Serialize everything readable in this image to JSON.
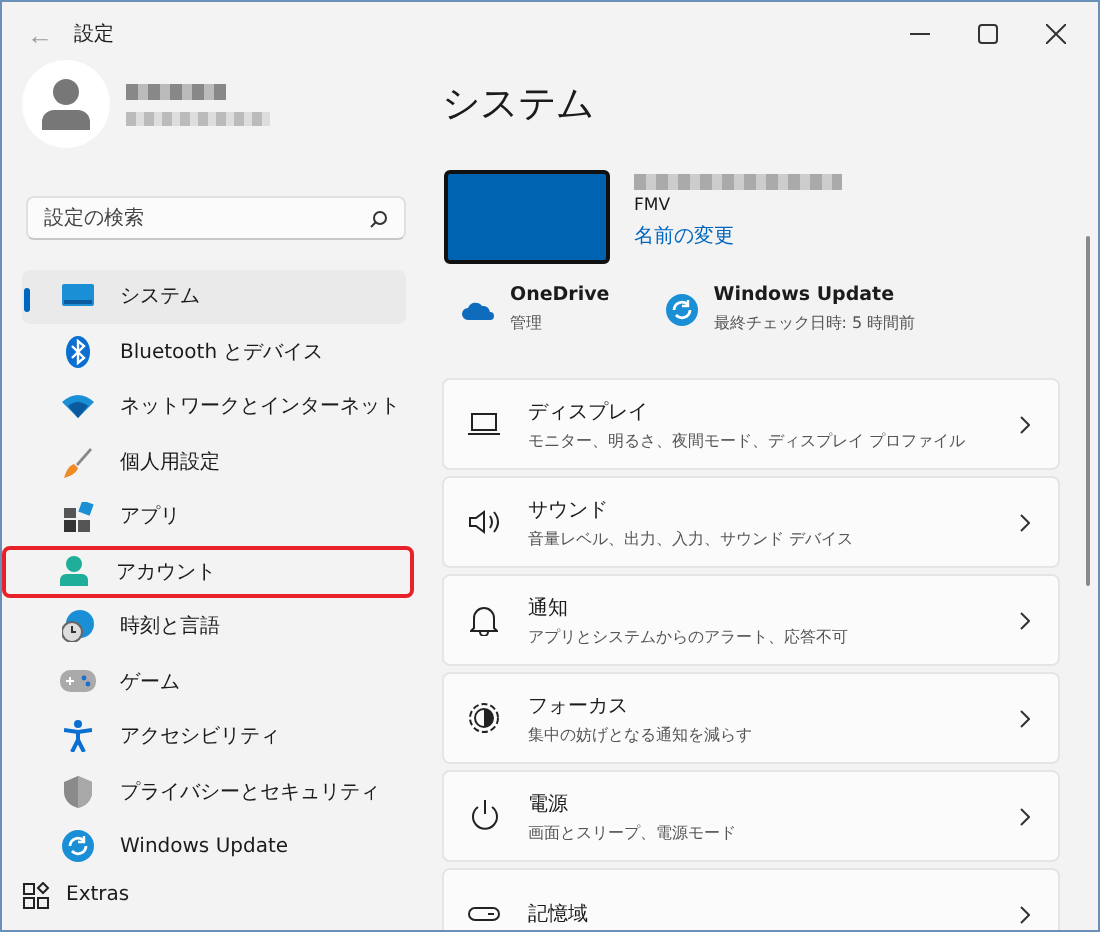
{
  "window": {
    "title": "設定",
    "back": "←"
  },
  "search": {
    "placeholder": "設定の検索"
  },
  "nav": [
    {
      "label": "システム",
      "selected": true,
      "highlighted": false
    },
    {
      "label": "Bluetooth とデバイス",
      "selected": false,
      "highlighted": false
    },
    {
      "label": "ネットワークとインターネット",
      "selected": false,
      "highlighted": false
    },
    {
      "label": "個人用設定",
      "selected": false,
      "highlighted": false
    },
    {
      "label": "アプリ",
      "selected": false,
      "highlighted": false
    },
    {
      "label": "アカウント",
      "selected": false,
      "highlighted": true
    },
    {
      "label": "時刻と言語",
      "selected": false,
      "highlighted": false
    },
    {
      "label": "ゲーム",
      "selected": false,
      "highlighted": false
    },
    {
      "label": "アクセシビリティ",
      "selected": false,
      "highlighted": false
    },
    {
      "label": "プライバシーとセキュリティ",
      "selected": false,
      "highlighted": false
    },
    {
      "label": "Windows Update",
      "selected": false,
      "highlighted": false
    }
  ],
  "extras": {
    "label": "Extras"
  },
  "page": {
    "title": "システム",
    "device_model": "FMV",
    "rename_link": "名前の変更",
    "quick_links": [
      {
        "title": "OneDrive",
        "subtitle": "管理"
      },
      {
        "title": "Windows Update",
        "subtitle": "最終チェック日時: 5 時間前"
      }
    ],
    "cards": [
      {
        "title": "ディスプレイ",
        "subtitle": "モニター、明るさ、夜間モード、ディスプレイ プロファイル"
      },
      {
        "title": "サウンド",
        "subtitle": "音量レベル、出力、入力、サウンド デバイス"
      },
      {
        "title": "通知",
        "subtitle": "アプリとシステムからのアラート、応答不可"
      },
      {
        "title": "フォーカス",
        "subtitle": "集中の妨げとなる通知を減らす"
      },
      {
        "title": "電源",
        "subtitle": "画面とスリープ、電源モード"
      },
      {
        "title": "記憶域"
      }
    ]
  }
}
